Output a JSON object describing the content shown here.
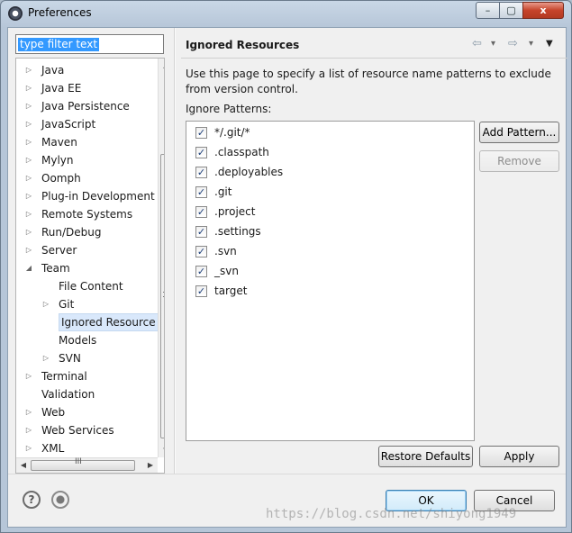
{
  "window": {
    "title": "Preferences",
    "min_glyph": "–",
    "max_glyph": "▢",
    "close_glyph": "x"
  },
  "filter": {
    "value": "type filter text"
  },
  "tree": {
    "items": [
      {
        "label": "Java",
        "twisty": "▷"
      },
      {
        "label": "Java EE",
        "twisty": "▷"
      },
      {
        "label": "Java Persistence",
        "twisty": "▷"
      },
      {
        "label": "JavaScript",
        "twisty": "▷"
      },
      {
        "label": "Maven",
        "twisty": "▷"
      },
      {
        "label": "Mylyn",
        "twisty": "▷"
      },
      {
        "label": "Oomph",
        "twisty": "▷"
      },
      {
        "label": "Plug-in Development",
        "twisty": "▷"
      },
      {
        "label": "Remote Systems",
        "twisty": "▷"
      },
      {
        "label": "Run/Debug",
        "twisty": "▷"
      },
      {
        "label": "Server",
        "twisty": "▷"
      },
      {
        "label": "Team",
        "twisty": "◢"
      },
      {
        "label": "File Content",
        "twisty": ""
      },
      {
        "label": "Git",
        "twisty": "▷"
      },
      {
        "label": "Ignored Resource",
        "twisty": ""
      },
      {
        "label": "Models",
        "twisty": ""
      },
      {
        "label": "SVN",
        "twisty": "▷"
      },
      {
        "label": "Terminal",
        "twisty": "▷"
      },
      {
        "label": "Validation",
        "twisty": ""
      },
      {
        "label": "Web",
        "twisty": "▷"
      },
      {
        "label": "Web Services",
        "twisty": "▷"
      },
      {
        "label": "XML",
        "twisty": "▷"
      }
    ],
    "scroll_up": "▲",
    "scroll_down": "▼",
    "scroll_left": "◀",
    "scroll_right": "▶",
    "hthumb_grip": "III"
  },
  "page": {
    "title": "Ignored Resources",
    "description": "Use this page to specify a list of resource name patterns to exclude from version control.",
    "patterns_label": "Ignore Patterns:",
    "nav_back": "⇦",
    "nav_back_menu": "▾",
    "nav_forward": "⇨",
    "nav_forward_menu": "▾",
    "view_menu": "▼"
  },
  "patterns": [
    {
      "label": "*/.git/*",
      "checked": true
    },
    {
      "label": ".classpath",
      "checked": true
    },
    {
      "label": ".deployables",
      "checked": true
    },
    {
      "label": ".git",
      "checked": true
    },
    {
      "label": ".project",
      "checked": true
    },
    {
      "label": ".settings",
      "checked": true
    },
    {
      "label": ".svn",
      "checked": true
    },
    {
      "label": "_svn",
      "checked": true
    },
    {
      "label": "target",
      "checked": true
    }
  ],
  "check_glyph": "✓",
  "buttons": {
    "add_pattern": "Add Pattern...",
    "remove": "Remove",
    "restore_defaults": "Restore Defaults",
    "apply": "Apply",
    "ok": "OK",
    "cancel": "Cancel"
  },
  "help_glyph": "?",
  "watermark": "https://blog.csdn.net/shiyong1949"
}
